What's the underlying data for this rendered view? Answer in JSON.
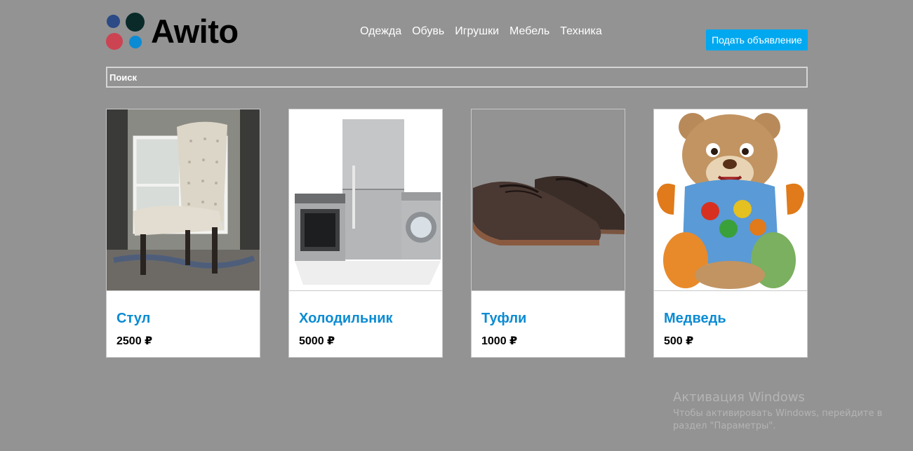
{
  "brand": {
    "name": "Awito",
    "dot_colors": [
      "#2b4a86",
      "#0a2a2a",
      "#cc4452",
      "#0b8bd3"
    ]
  },
  "nav": {
    "items": [
      "Одежда",
      "Обувь",
      "Игрушки",
      "Мебель",
      "Техника"
    ]
  },
  "header": {
    "post_button_label": "Подать объявление",
    "accent_color": "#00a8f0"
  },
  "search": {
    "placeholder": "Поиск",
    "value": ""
  },
  "products": [
    {
      "title": "Стул",
      "price": "2500 ₽",
      "image": "chair-photo"
    },
    {
      "title": "Холодильник",
      "price": "5000 ₽",
      "image": "fridge-photo"
    },
    {
      "title": "Туфли",
      "price": "1000 ₽",
      "image": "shoes-photo"
    },
    {
      "title": "Медведь",
      "price": "500 ₽",
      "image": "teddy-bear-photo"
    }
  ],
  "watermark": {
    "title": "Активация Windows",
    "line1": "Чтобы активировать Windows, перейдите в",
    "line2": "раздел \"Параметры\"."
  }
}
